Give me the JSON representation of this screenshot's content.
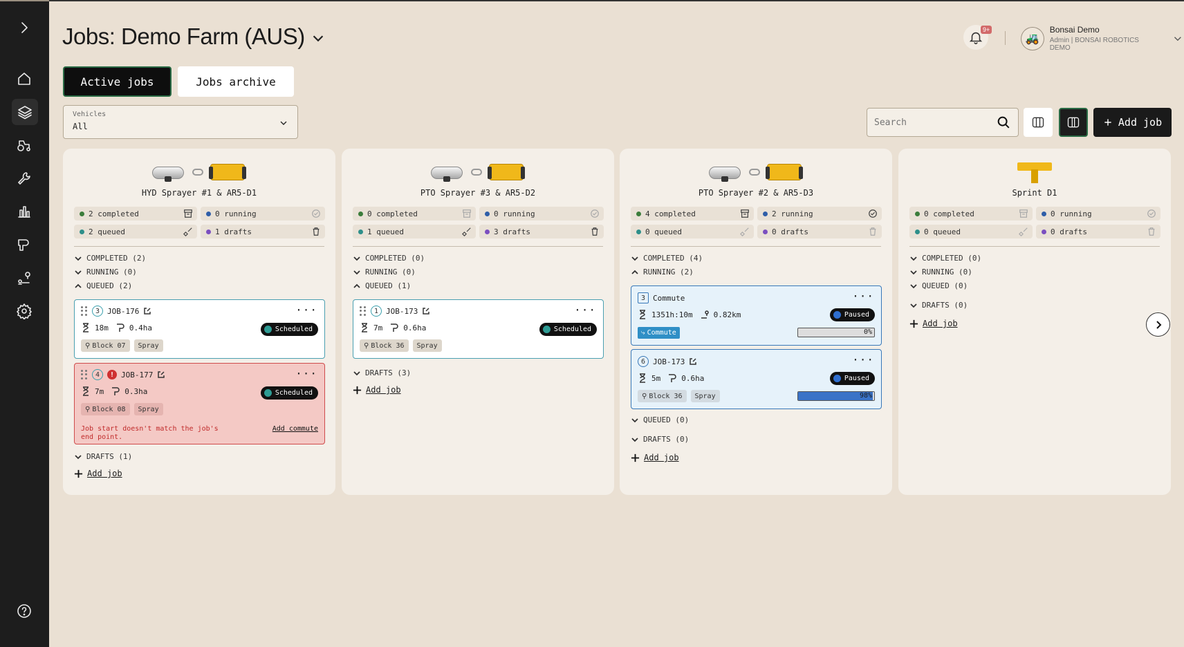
{
  "page": {
    "title": "Jobs: Demo Farm (AUS)"
  },
  "header": {
    "notification_badge": "9+",
    "user_name": "Bonsai Demo",
    "user_role": "Admin | BONSAI ROBOTICS DEMO"
  },
  "tabs": {
    "active": "Active jobs",
    "archive": "Jobs archive"
  },
  "filter": {
    "label": "Vehicles",
    "value": "All"
  },
  "search": {
    "placeholder": "Search"
  },
  "toolbar": {
    "add_job": "Add job"
  },
  "columns": [
    {
      "vehicle": "HYD Sprayer #1 & AR5-D1",
      "stats": {
        "completed": "2 completed",
        "running": "0 running",
        "queued": "2 queued",
        "drafts": "1 drafts"
      },
      "sections": {
        "completed": "COMPLETED (2)",
        "running": "RUNNING (0)",
        "queued": "QUEUED (2)",
        "drafts": "DRAFTS (1)"
      },
      "jobs": [
        {
          "num": "3",
          "name": "JOB-176",
          "time": "18m",
          "area": "0.4ha",
          "status": "Scheduled",
          "block": "Block 07",
          "type": "Spray"
        },
        {
          "num": "4",
          "name": "JOB-177",
          "time": "7m",
          "area": "0.3ha",
          "status": "Scheduled",
          "block": "Block 08",
          "type": "Spray",
          "error": "Job start doesn't match the job's end point.",
          "action": "Add commute"
        }
      ],
      "add": "Add job"
    },
    {
      "vehicle": "PTO Sprayer #3 & AR5-D2",
      "stats": {
        "completed": "0 completed",
        "running": "0 running",
        "queued": "1 queued",
        "drafts": "3 drafts"
      },
      "sections": {
        "completed": "COMPLETED (0)",
        "running": "RUNNING (0)",
        "queued": "QUEUED (1)",
        "drafts": "DRAFTS (3)"
      },
      "jobs": [
        {
          "num": "1",
          "name": "JOB-173",
          "time": "7m",
          "area": "0.6ha",
          "status": "Scheduled",
          "block": "Block 36",
          "type": "Spray"
        }
      ],
      "add": "Add job"
    },
    {
      "vehicle": "PTO Sprayer #2 & AR5-D3",
      "stats": {
        "completed": "4 completed",
        "running": "2 running",
        "queued": "0 queued",
        "drafts": "0 drafts"
      },
      "sections": {
        "completed": "COMPLETED (4)",
        "running": "RUNNING (2)",
        "queued": "QUEUED (0)",
        "drafts": "DRAFTS (0)"
      },
      "jobs": [
        {
          "num": "3",
          "name": "Commute",
          "time": "1351h:10m",
          "dist": "0.82km",
          "status": "Paused",
          "tag": "Commute",
          "progress_label": "0%",
          "progress": 0
        },
        {
          "num": "6",
          "name": "JOB-173",
          "time": "5m",
          "area": "0.6ha",
          "status": "Paused",
          "block": "Block 36",
          "type": "Spray",
          "progress_label": "98%",
          "progress": 98
        }
      ],
      "add": "Add job"
    },
    {
      "vehicle": "Sprint D1",
      "stats": {
        "completed": "0 completed",
        "running": "0 running",
        "queued": "0 queued",
        "drafts": "0 drafts"
      },
      "sections": {
        "completed": "COMPLETED (0)",
        "running": "RUNNING (0)",
        "queued": "QUEUED (0)",
        "drafts": "DRAFTS (0)"
      },
      "jobs": [],
      "add": "Add job"
    }
  ],
  "icons": {
    "sidebar": [
      "chevron-right-icon",
      "home-icon",
      "layers-icon",
      "tractor-icon",
      "wrench-icon",
      "bar-chart-icon",
      "field-map-icon",
      "route-icon",
      "settings-icon",
      "help-icon"
    ]
  },
  "colors": {
    "completed": "#3b7d3b",
    "running": "#2f5ea8",
    "queued": "#2e8f8a",
    "drafts": "#7b4fc0",
    "error": "#cf3030",
    "accent": "#2a6b45"
  }
}
